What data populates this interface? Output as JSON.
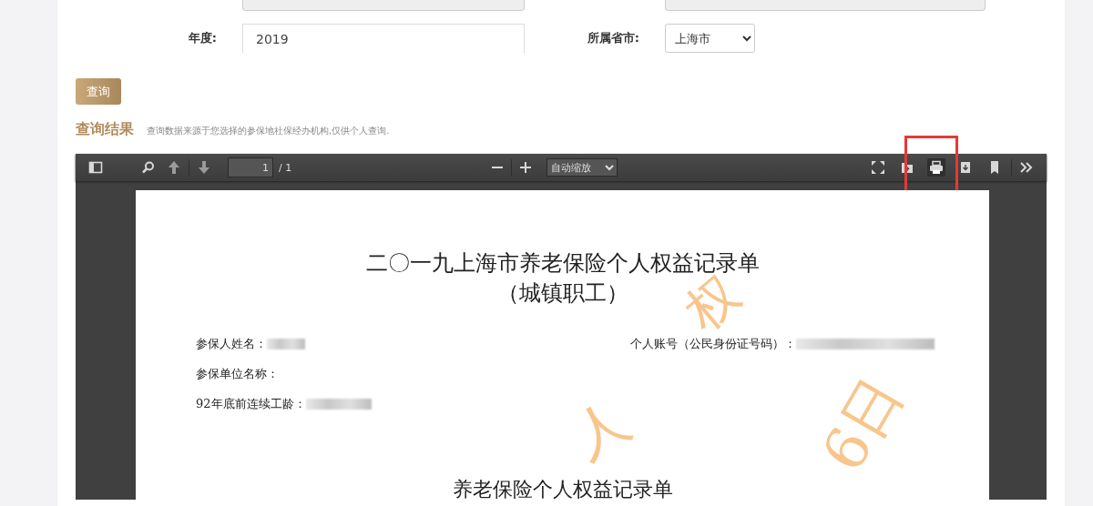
{
  "form": {
    "fields": [
      {
        "label": "年度:",
        "kind": "input",
        "value": "2019"
      },
      {
        "label": "所属省市:",
        "kind": "select",
        "value": "上海市"
      }
    ],
    "query_button": "查询"
  },
  "results": {
    "title": "查询结果",
    "note": "查询数据来源于您选择的参保地社保经办机构,仅供个人查询."
  },
  "viewer": {
    "page_number": "1",
    "page_count": "/ 1",
    "zoom": "自动缩放",
    "tools": [
      {
        "kind": "fullscreen",
        "highlighted": false
      },
      {
        "kind": "open",
        "highlighted": false
      },
      {
        "kind": "print",
        "highlighted": true
      },
      {
        "kind": "download",
        "highlighted": false
      },
      {
        "kind": "bookmark",
        "highlighted": false
      }
    ]
  },
  "document": {
    "title": "二〇一九上海市养老保险个人权益记录单",
    "subtitle": "（城镇职工）",
    "rows": [
      {
        "cells": [
          {
            "label": "参保人姓名：",
            "redacted": true
          },
          {
            "label": "个人账号（公民身份证号码）：",
            "redacted": true
          }
        ]
      },
      {
        "cells": [
          {
            "label": "参保单位名称：",
            "redacted": false
          }
        ]
      },
      {
        "cells": [
          {
            "label": "92年底前连续工龄：",
            "redacted": true
          }
        ]
      }
    ],
    "section_title": "养老保险个人权益记录单",
    "stamp": [
      "权",
      "人",
      "6日"
    ]
  }
}
